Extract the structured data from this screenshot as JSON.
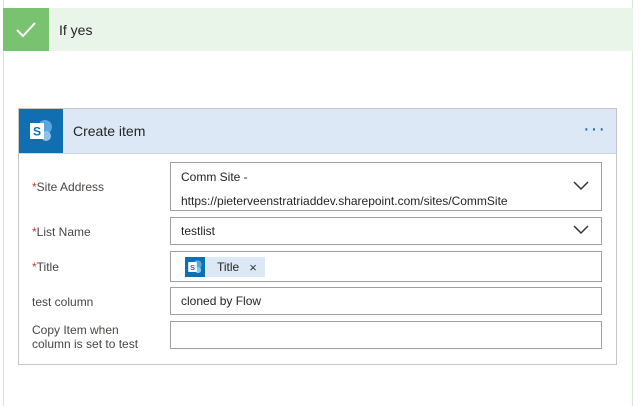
{
  "condition": {
    "label": "If yes"
  },
  "action": {
    "title": "Create item",
    "more_label": "···",
    "fields": {
      "site_address": {
        "label": "Site Address",
        "required": "*",
        "value_line1": "Comm Site -",
        "value_line2": "https://pieterveenstratriaddev.sharepoint.com/sites/CommSite"
      },
      "list_name": {
        "label": "List Name",
        "required": "*",
        "value": "testlist"
      },
      "title": {
        "label": "Title",
        "required": "*",
        "token_label": "Title",
        "token_remove": "×"
      },
      "test_column": {
        "label": "test column",
        "value": "cloned by Flow"
      },
      "copy_item": {
        "label_line1": "Copy Item when",
        "label_line2": "column is set to test",
        "value": ""
      }
    }
  },
  "colors": {
    "success_green": "#79c370",
    "success_bg": "#e9f5e8",
    "sharepoint_blue": "#0f6fb0",
    "header_bg": "#dce8f5",
    "required_red": "#c63c2c"
  },
  "icons": {
    "condition": "checkmark-icon",
    "connector": "sharepoint-icon",
    "dropdown": "chevron-down-icon",
    "token_remove": "close-icon"
  }
}
